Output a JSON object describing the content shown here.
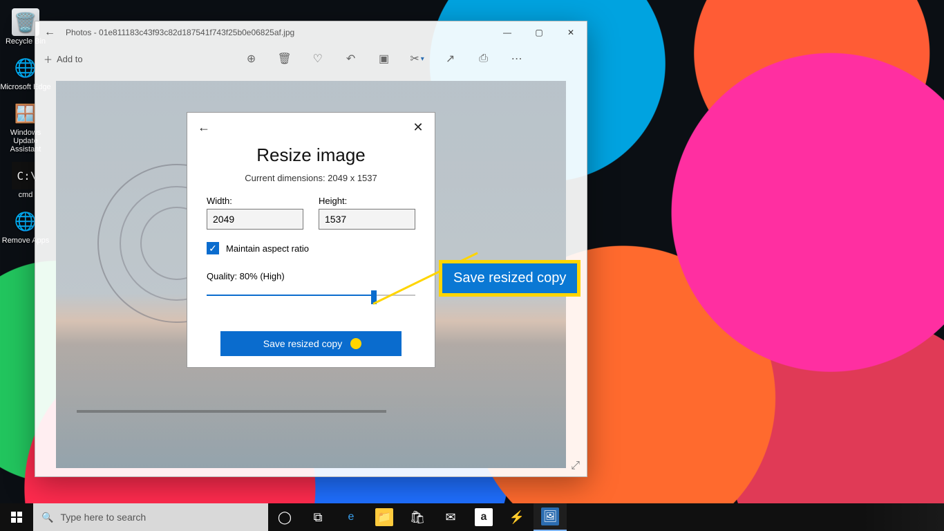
{
  "desktop_icons": {
    "recycle": "Recycle Bin",
    "edge": "Microsoft Edge",
    "wu": "Windows Update Assistant",
    "cmd": "cmd",
    "ra": "Remove Apps"
  },
  "window": {
    "title": "Photos - 01e811183c43f93c82d187541f743f25b0e06825af.jpg",
    "add_to": "Add to"
  },
  "dialog": {
    "title": "Resize image",
    "current_dimensions": "Current dimensions: 2049 x 1537",
    "width_label": "Width:",
    "width_value": "2049",
    "height_label": "Height:",
    "height_value": "1537",
    "maintain_aspect": "Maintain aspect ratio",
    "quality_label": "Quality: 80% (High)",
    "quality_percent": 80,
    "save_button": "Save resized copy"
  },
  "callout": {
    "text": "Save resized copy"
  },
  "taskbar": {
    "search_placeholder": "Type here to search"
  },
  "colors": {
    "accent": "#0a6cce",
    "highlight": "#ffd500"
  }
}
